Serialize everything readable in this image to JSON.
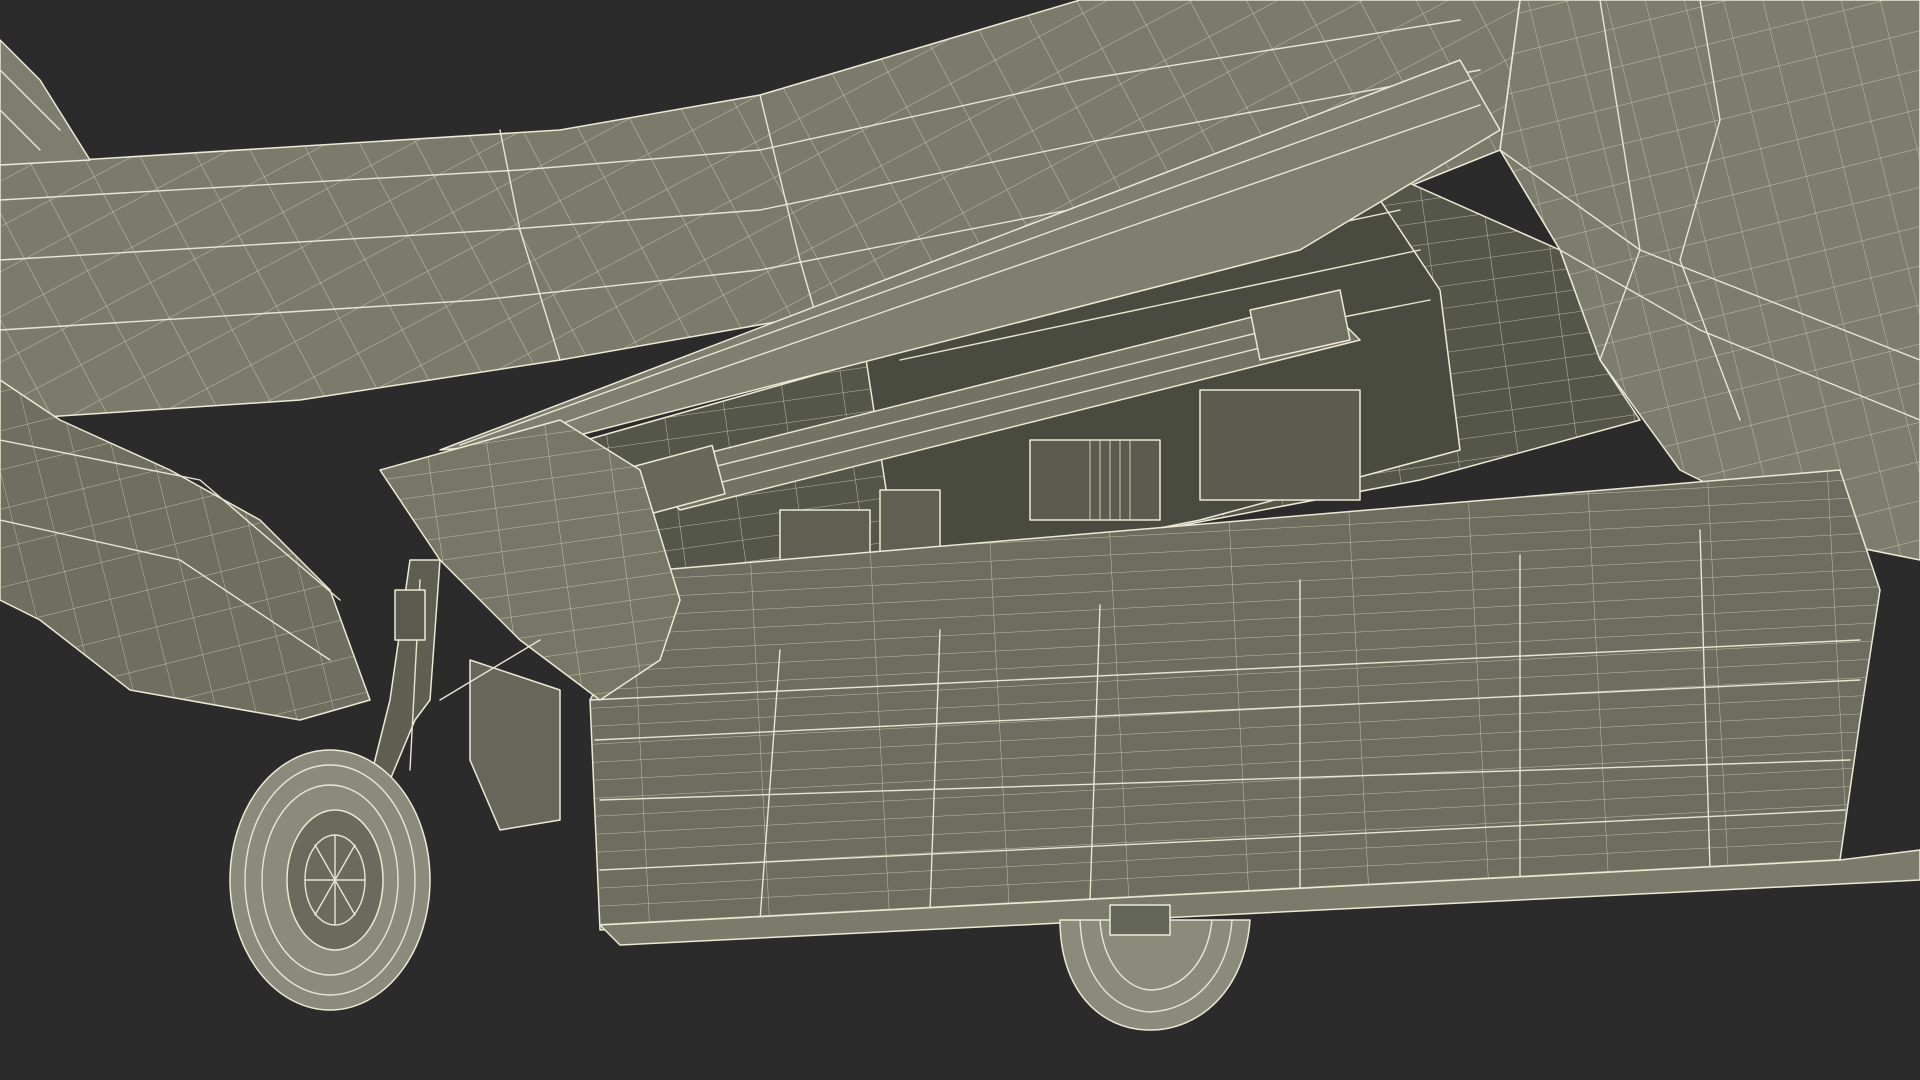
{
  "viewport": {
    "background_color": "#2b2b2b",
    "wireframe_color": "#e8e6d2",
    "surface_colors": {
      "light": "#7b7c6c",
      "mid": "#6c6d5e",
      "dark": "#56574a",
      "deep": "#46473c"
    }
  }
}
